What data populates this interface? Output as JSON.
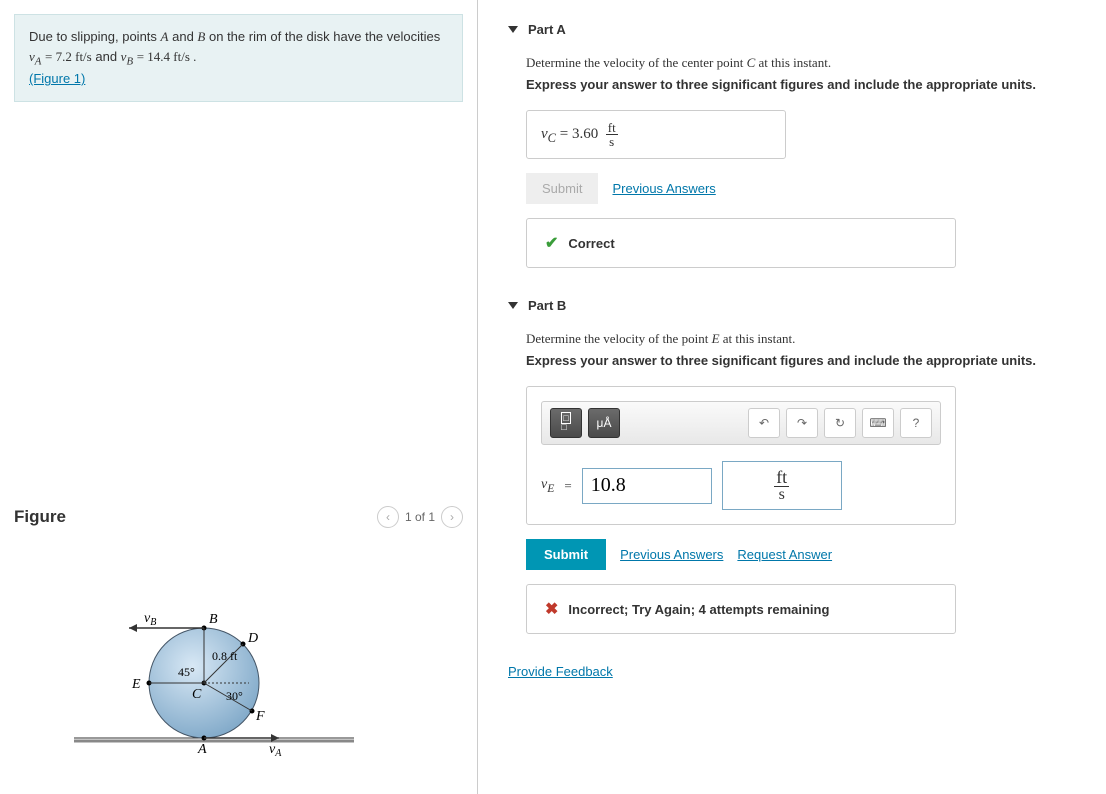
{
  "problem": {
    "text_prefix": "Due to slipping, points ",
    "pointA": "A",
    "text_mid1": " and ",
    "pointB": "B",
    "text_mid2": " on the rim of the disk have the velocities ",
    "vA_label": "v",
    "vA_sub": "A",
    "vA_eq": " = 7.2 ft/s",
    "text_and": " and ",
    "vB_label": "v",
    "vB_sub": "B",
    "vB_eq": " = 14.4 ft/s .",
    "figure_link": "(Figure 1)"
  },
  "figure": {
    "heading": "Figure",
    "pager": "1 of 1",
    "labels": {
      "vB": "v",
      "vB_sub": "B",
      "B": "B",
      "D": "D",
      "radius": "0.8 ft",
      "angle45": "45°",
      "E": "E",
      "C": "C",
      "angle30": "30°",
      "F": "F",
      "A": "A",
      "vA": "v",
      "vA_sub": "A"
    }
  },
  "partA": {
    "title": "Part A",
    "question": "Determine the velocity of the center point C at this instant.",
    "instruction": "Express your answer to three significant figures and include the appropriate units.",
    "var": "v",
    "sub": "C",
    "eq": " = ",
    "value": "3.60",
    "unit_num": "ft",
    "unit_den": "s",
    "submit": "Submit",
    "prev_answers": "Previous Answers",
    "feedback": "Correct"
  },
  "partB": {
    "title": "Part B",
    "question": "Determine the velocity of the point E at this instant.",
    "instruction": "Express your answer to three significant figures and include the appropriate units.",
    "toolbar": {
      "templates": "▭/▭",
      "units": "μÅ",
      "undo": "↶",
      "redo": "↷",
      "reset": "↻",
      "keyboard": "⌨",
      "help": "?"
    },
    "var": "v",
    "sub": "E",
    "eq": " = ",
    "value": "10.8",
    "unit_num": "ft",
    "unit_den": "s",
    "submit": "Submit",
    "prev_answers": "Previous Answers",
    "request_answer": "Request Answer",
    "feedback": "Incorrect; Try Again; 4 attempts remaining"
  },
  "provide_feedback": "Provide Feedback"
}
